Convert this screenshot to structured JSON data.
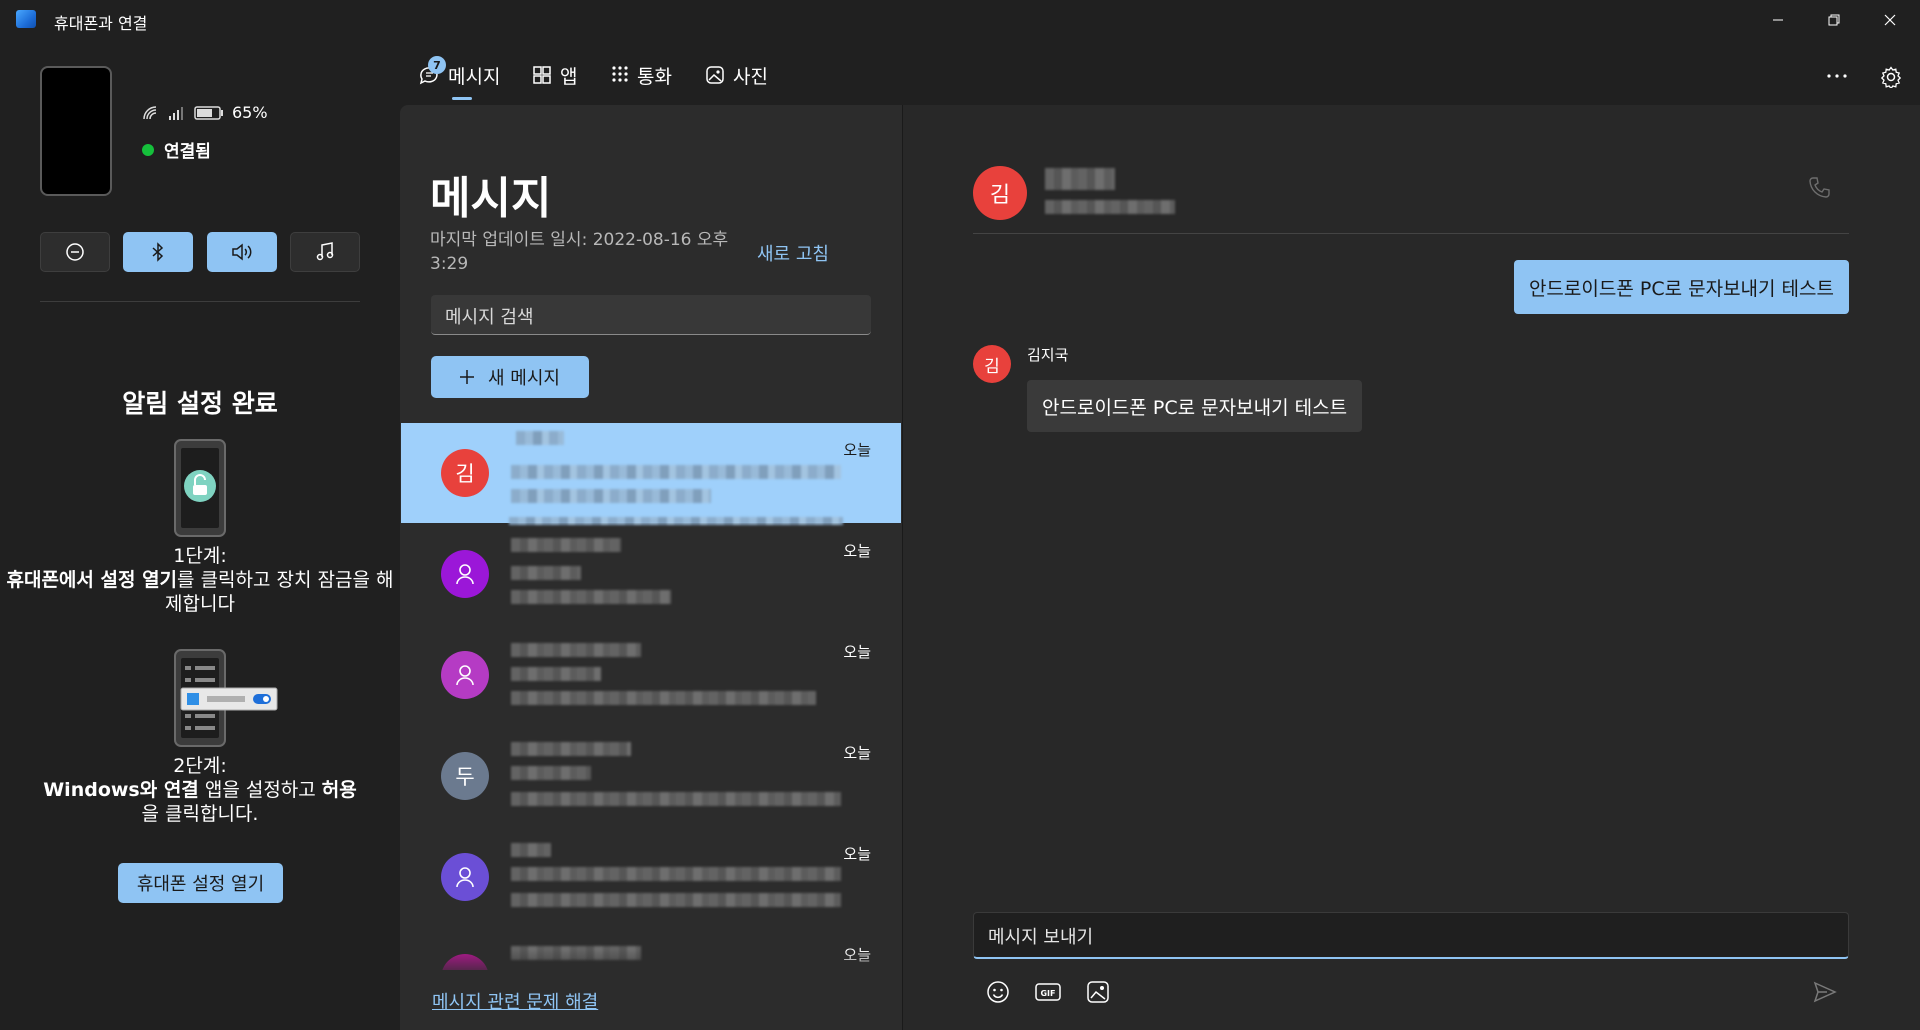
{
  "window": {
    "title": "휴대폰과 연결",
    "icons": [
      "app-icon",
      "minimize-icon",
      "restore-icon",
      "close-icon"
    ]
  },
  "device": {
    "battery": "65%",
    "status": "연결됨",
    "quick_actions": [
      {
        "name": "do-not-disturb",
        "icon": "minus-circle-icon",
        "active": false
      },
      {
        "name": "bluetooth",
        "icon": "bluetooth-icon",
        "active": true
      },
      {
        "name": "audio",
        "icon": "speaker-icon",
        "active": true
      },
      {
        "name": "media",
        "icon": "music-note-icon",
        "active": false
      }
    ]
  },
  "notifications": {
    "title": "알림 설정 완료",
    "step1_heading": "1단계:",
    "step1_bold": "휴대폰에서 설정 열기",
    "step1_rest": "를 클릭하고 장치 잠금을 해제합니다",
    "step2_heading": "2단계:",
    "step2_bold1": "Windows와 연결",
    "step2_mid": " 앱을 설정하고 ",
    "step2_bold2": "허용",
    "step2_rest": "을 클릭합니다.",
    "button": "휴대폰 설정 열기"
  },
  "tabs": [
    {
      "label": "메시지",
      "icon": "message-icon",
      "badge": "7",
      "active": true
    },
    {
      "label": "앱",
      "icon": "apps-icon"
    },
    {
      "label": "통화",
      "icon": "dialpad-icon"
    },
    {
      "label": "사진",
      "icon": "photo-icon"
    }
  ],
  "messages": {
    "title": "메시지",
    "last_update": "마지막 업데이트 일시: 2022-08-16 오후 3:29",
    "refresh": "새로 고침",
    "search_placeholder": "메시지 검색",
    "new_message": "새 메시지",
    "troubleshoot": "메시지 관련 문제 해결",
    "conversations": [
      {
        "avatar": "김",
        "color": "#e8413c",
        "time": "오늘",
        "selected": true
      },
      {
        "avatar": "person-icon",
        "color": "#9b17d8",
        "time": "오늘"
      },
      {
        "avatar": "person-icon",
        "color": "#b53bc4",
        "time": "오늘"
      },
      {
        "avatar": "두",
        "color": "#6b7a8f",
        "time": "오늘"
      },
      {
        "avatar": "person-icon",
        "color": "#6b4fd6",
        "time": "오늘"
      },
      {
        "avatar": "",
        "color": "#b0188f",
        "time": "오늘"
      }
    ]
  },
  "chat": {
    "avatar": "김",
    "outgoing": "안드로이드폰 PC로 문자보내기 테스트",
    "incoming_name": "김지국",
    "incoming_avatar": "김",
    "incoming": "안드로이드폰 PC로 문자보내기 테스트",
    "input_placeholder": "메시지 보내기",
    "toolbar_icons": [
      "emoji-icon",
      "gif-icon",
      "image-icon",
      "send-icon"
    ]
  },
  "colors": {
    "accent": "#8fc4f3",
    "selected_row": "#9fd0fb",
    "connected": "#15c03b",
    "avatar_red": "#e8413c"
  }
}
